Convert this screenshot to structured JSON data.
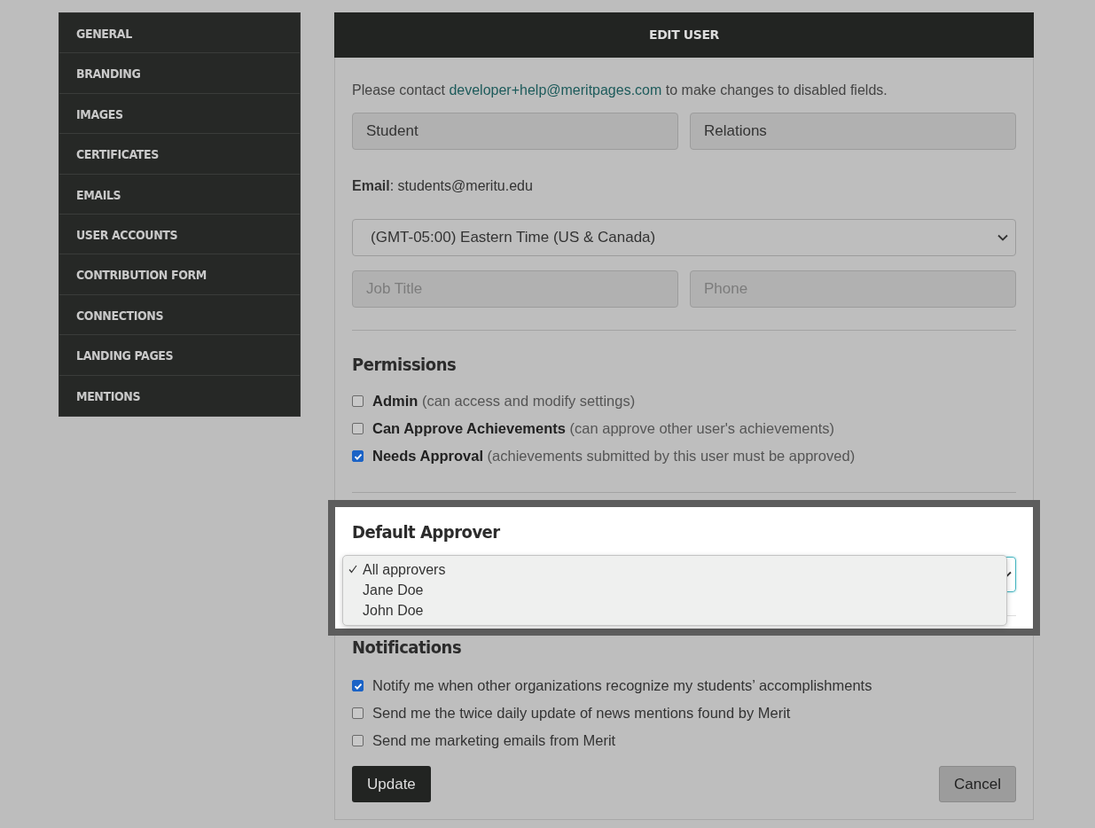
{
  "sidebar": {
    "items": [
      {
        "label": "GENERAL"
      },
      {
        "label": "BRANDING"
      },
      {
        "label": "IMAGES"
      },
      {
        "label": "CERTIFICATES"
      },
      {
        "label": "EMAILS"
      },
      {
        "label": "USER ACCOUNTS"
      },
      {
        "label": "CONTRIBUTION FORM"
      },
      {
        "label": "CONNECTIONS"
      },
      {
        "label": "LANDING PAGES"
      },
      {
        "label": "MENTIONS"
      }
    ]
  },
  "panel": {
    "title": "EDIT USER",
    "notice": {
      "before": "Please contact",
      "link": "developer+help@meritpages.com",
      "after": "to make changes to disabled fields."
    },
    "name_fields": [
      {
        "value": "Student"
      },
      {
        "value": "Relations"
      }
    ],
    "email": {
      "text": "**Email**: students@meritu.edu"
    },
    "timezone": {
      "value": "(GMT-05:00) Eastern Time (US & Canada)"
    },
    "contact_fields": [
      {
        "placeholder": "Job Title"
      },
      {
        "placeholder": "Phone"
      }
    ],
    "permissions": {
      "heading": "Permissions",
      "items": [
        {
          "label": "Admin",
          "description": "(can access and modify settings)",
          "checked": false
        },
        {
          "label": "Can Approve Achievements",
          "description": "(can approve other user's achievements)",
          "checked": false
        },
        {
          "label": "Needs Approval",
          "description": "(achievements submitted by this user must be approved)",
          "checked": true
        }
      ]
    },
    "default_approver": {
      "heading": "Default Approver",
      "options": [
        {
          "label": "All approvers",
          "selected": true
        },
        {
          "label": "Jane Doe",
          "selected": false
        },
        {
          "label": "John Doe",
          "selected": false
        }
      ]
    },
    "notifications": {
      "heading": "Notifications",
      "items": [
        {
          "label": "Notify me when other organizations recognize my students’ accomplishments",
          "checked": true
        },
        {
          "label": "Send me the twice daily update of news mentions found by Merit",
          "checked": false
        },
        {
          "label": "Send me marketing emails from Merit",
          "checked": false
        }
      ]
    },
    "buttons": {
      "update": "Update",
      "cancel": "Cancel"
    }
  }
}
